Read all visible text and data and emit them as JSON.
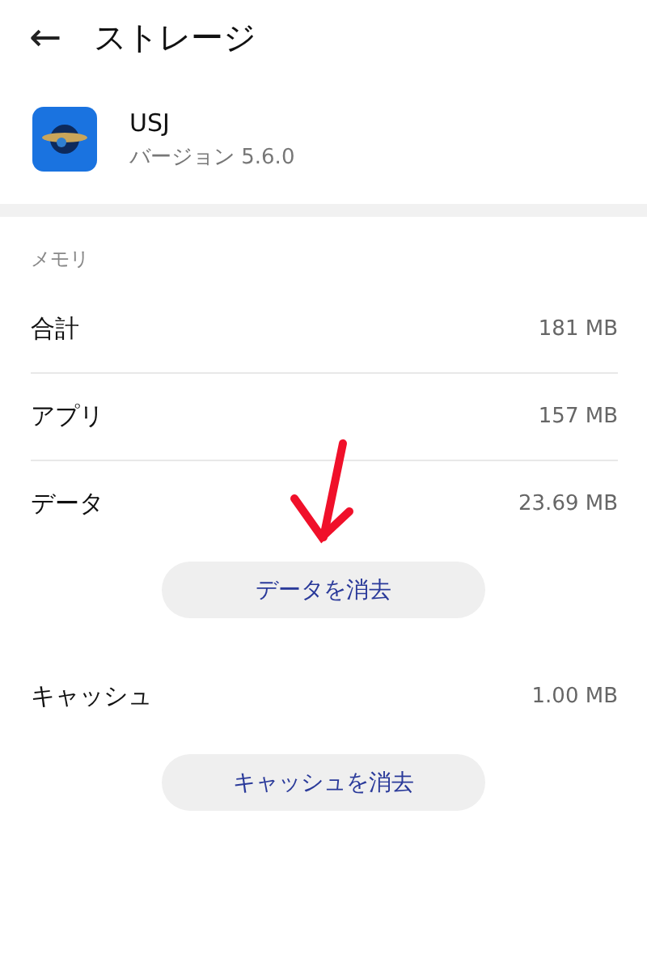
{
  "header": {
    "back_icon": "←",
    "title": "ストレージ"
  },
  "app": {
    "name": "USJ",
    "version": "バージョン 5.6.0"
  },
  "section": {
    "title": "メモリ",
    "items": [
      {
        "kind": "value",
        "label": "合計",
        "value": "181 MB",
        "divider": true
      },
      {
        "kind": "value",
        "label": "アプリ",
        "value": "157 MB",
        "divider": true
      },
      {
        "kind": "value",
        "label": "データ",
        "value": "23.69 MB",
        "divider": false
      },
      {
        "kind": "button",
        "label": "データを消去"
      },
      {
        "kind": "value",
        "label": "キャッシュ",
        "value": "1.00 MB",
        "divider": false
      },
      {
        "kind": "button",
        "label": "キャッシュを消去"
      }
    ]
  }
}
